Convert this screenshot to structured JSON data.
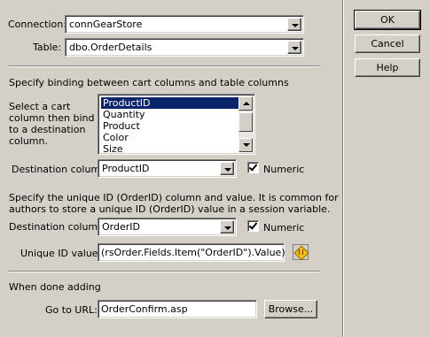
{
  "connection": {
    "label": "Connection:",
    "value": "connGearStore"
  },
  "table": {
    "label": "Table:",
    "value": "dbo.OrderDetails"
  },
  "buttons": {
    "ok": "OK",
    "cancel": "Cancel",
    "help": "Help",
    "browse": "Browse..."
  },
  "binding": {
    "heading": "Specify binding between cart columns and table columns",
    "select_label_lines": [
      "Select a cart",
      "column then bind it",
      "to a destination",
      "column."
    ],
    "cart_columns": [
      "ProductID",
      "Quantity",
      "Product",
      "Color",
      "Size"
    ],
    "selected_index": 0,
    "dest_label": "Destination column:",
    "dest_value": "ProductID",
    "numeric_label": "Numeric",
    "numeric_checked": true
  },
  "unique": {
    "desc_lines": [
      "Specify the unique ID (OrderID) column and value. It is common for",
      "authors to store a unique ID (OrderID) value in a session variable."
    ],
    "dest_label": "Destination column:",
    "dest_value": "OrderID",
    "numeric_label": "Numeric",
    "numeric_checked": true,
    "value_label": "Unique ID value:",
    "value": "(rsOrder.Fields.Item(\"OrderID\").Value)"
  },
  "done": {
    "heading": "When done adding",
    "url_label": "Go to URL:",
    "url_value": "OrderConfirm.asp"
  },
  "colors": {
    "face": "#d4d0c8",
    "selection": "#0a246a"
  },
  "icons": {
    "dynamic_data": "lightning-icon"
  }
}
